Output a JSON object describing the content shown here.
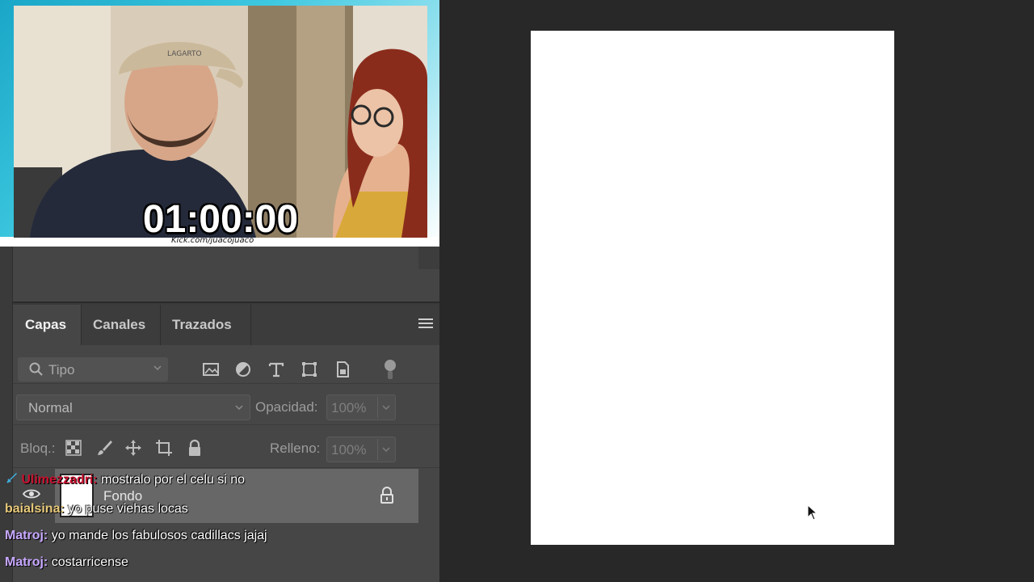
{
  "webcam": {
    "timer": "01:00:00",
    "url": "Kick.com/juacojuaco",
    "cap_text": "LAGARTO"
  },
  "layers_panel": {
    "tabs": [
      {
        "label": "Capas",
        "active": true
      },
      {
        "label": "Canales",
        "active": false
      },
      {
        "label": "Trazados",
        "active": false
      }
    ],
    "filter": {
      "placeholder": "Tipo"
    },
    "blend_mode": "Normal",
    "opacity_label": "Opacidad:",
    "opacity_value": "100%",
    "lock_label": "Bloq.:",
    "fill_label": "Relleno:",
    "fill_value": "100%",
    "layer": {
      "name": "Fondo"
    }
  },
  "chat": [
    {
      "user": "Ulimezzadri:",
      "text": "mostralo por el celu si no",
      "color": "#c8102e"
    },
    {
      "user": "baialsina:",
      "text": "yo puse viehas locas",
      "color": "#e8c97a"
    },
    {
      "user": "Matroj:",
      "text": "yo mande los fabulosos cadillacs jajaj",
      "color": "#c7a8ff"
    },
    {
      "user": "Matroj:",
      "text": "costarricense",
      "color": "#c7a8ff"
    }
  ],
  "colors": {
    "panel_bg": "#464646",
    "canvas_bg": "#282828",
    "document": "#ffffff",
    "frame_accent": "#1aa6c7"
  }
}
